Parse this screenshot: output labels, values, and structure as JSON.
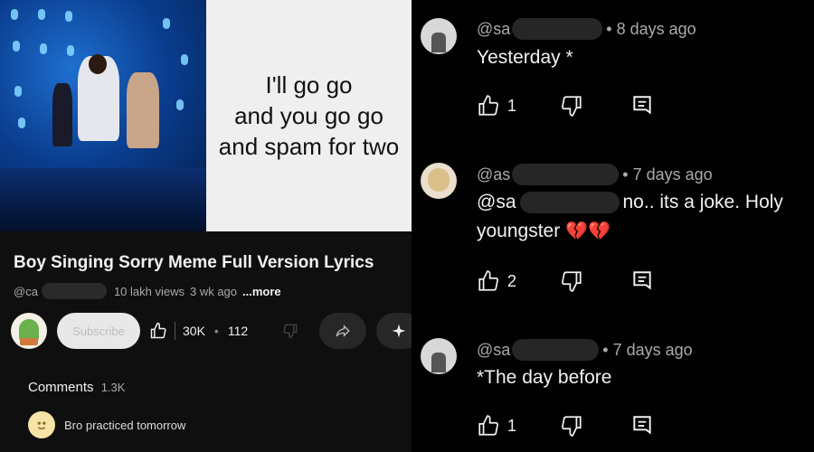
{
  "video": {
    "caption_lines": [
      "I'll go go",
      "and you go go",
      "and spam for two"
    ],
    "title": "Boy Singing Sorry Meme Full Version Lyrics",
    "channel_prefix": "@ca",
    "views": "10 lakh views",
    "age": "3 wk ago",
    "more_label": "...more",
    "subscribe_label": "Subscribe",
    "like_count": "30K",
    "second_count": "112"
  },
  "comments_section": {
    "label": "Comments",
    "count": "1.3K",
    "first_comment": "Bro practiced tomorrow"
  },
  "replies": [
    {
      "handle": "@sa",
      "time": "• 8 days ago",
      "text": "Yesterday *",
      "likes": "1"
    },
    {
      "handle": "@as",
      "time": "• 7 days ago",
      "mention": "@sa",
      "text_after": "no.. its a joke. Holy",
      "text_line2": "youngster",
      "emoji": "💔💔",
      "likes": "2"
    },
    {
      "handle": "@sa",
      "time": "• 7 days ago",
      "text": "*The day before",
      "likes": "1"
    }
  ]
}
